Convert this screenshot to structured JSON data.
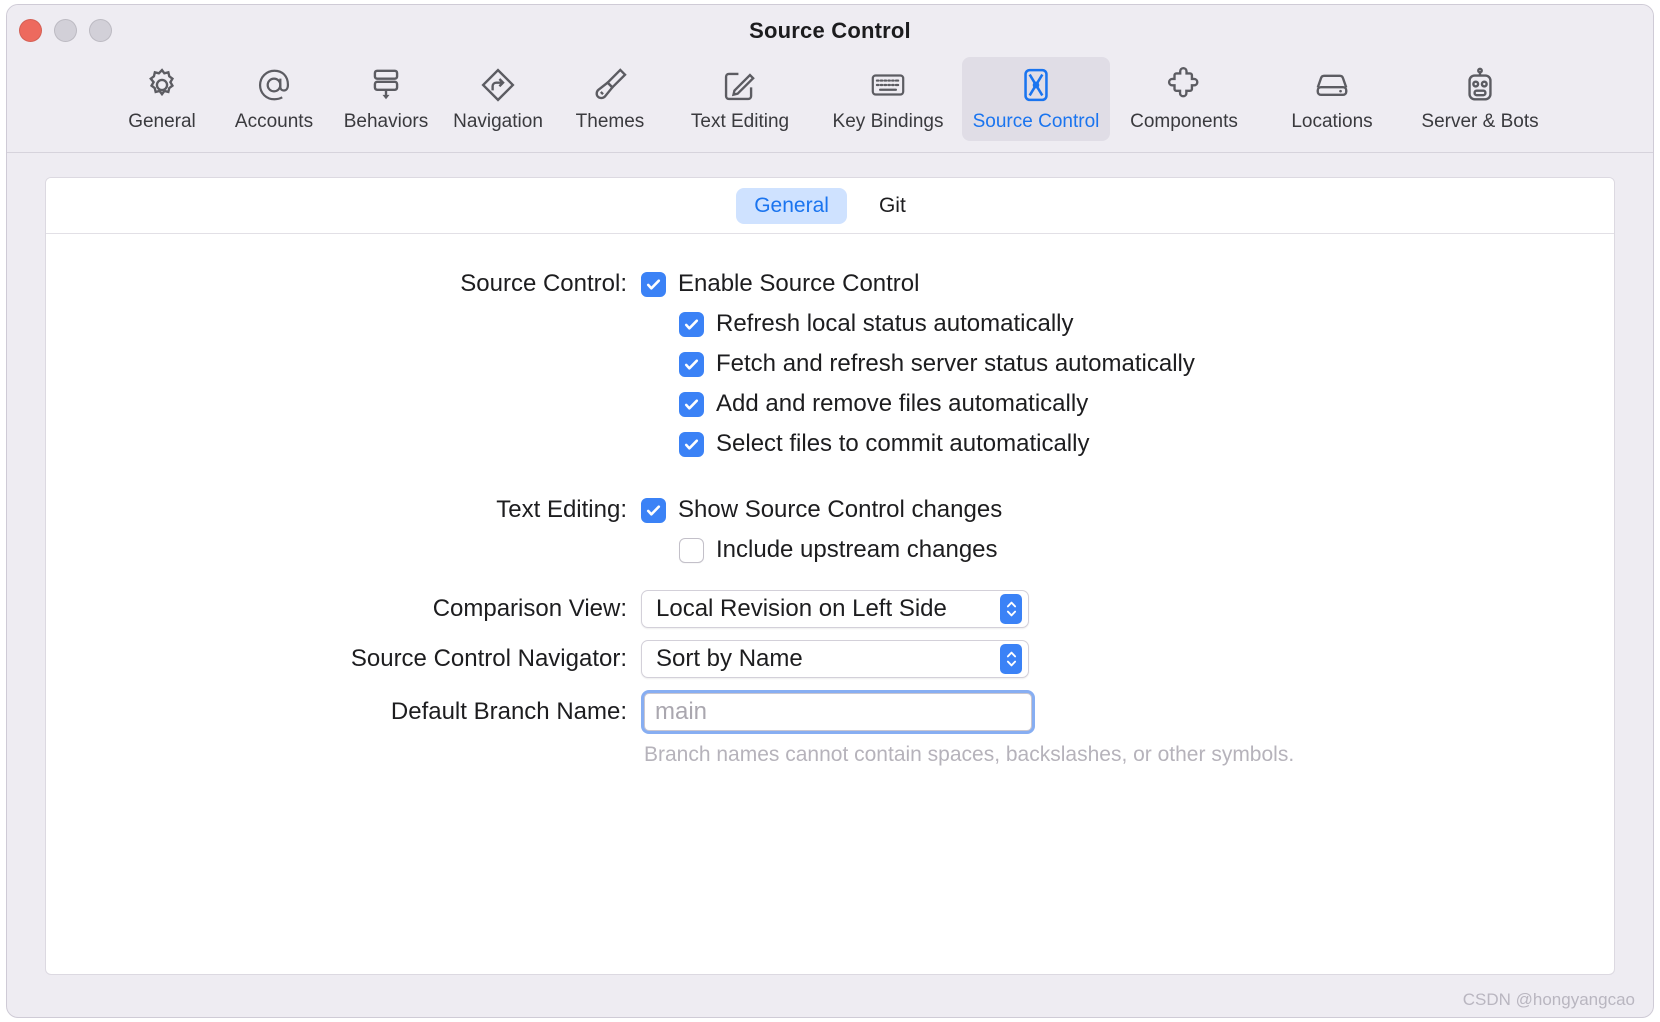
{
  "window": {
    "title": "Source Control",
    "traffic_lights": [
      {
        "name": "close",
        "color": "#ed6a5e"
      },
      {
        "name": "minimize",
        "color": "#d2d0d8"
      },
      {
        "name": "maximize",
        "color": "#d2d0d8"
      }
    ]
  },
  "toolbar": {
    "items": [
      {
        "label": "General",
        "icon": "gear-icon"
      },
      {
        "label": "Accounts",
        "icon": "at-sign-icon"
      },
      {
        "label": "Behaviors",
        "icon": "behaviors-icon"
      },
      {
        "label": "Navigation",
        "icon": "navigation-arrow-icon"
      },
      {
        "label": "Themes",
        "icon": "paintbrush-icon"
      },
      {
        "label": "Text Editing",
        "icon": "pencil-square-icon"
      },
      {
        "label": "Key Bindings",
        "icon": "keyboard-icon"
      },
      {
        "label": "Source Control",
        "icon": "source-control-icon",
        "selected": true
      },
      {
        "label": "Components",
        "icon": "puzzle-piece-icon"
      },
      {
        "label": "Locations",
        "icon": "disk-drive-icon"
      },
      {
        "label": "Server & Bots",
        "icon": "robot-icon"
      }
    ],
    "selected_color": "#1a74ef"
  },
  "tabs": [
    {
      "label": "General",
      "active": true
    },
    {
      "label": "Git",
      "active": false
    }
  ],
  "form": {
    "source_control_label": "Source Control:",
    "text_editing_label": "Text Editing:",
    "comparison_view_label": "Comparison View:",
    "navigator_label": "Source Control Navigator:",
    "branch_label": "Default Branch Name:",
    "checkboxes": [
      {
        "label": "Enable Source Control",
        "checked": true,
        "indent": false
      },
      {
        "label": "Refresh local status automatically",
        "checked": true,
        "indent": true
      },
      {
        "label": "Fetch and refresh server status automatically",
        "checked": true,
        "indent": true
      },
      {
        "label": "Add and remove files automatically",
        "checked": true,
        "indent": true
      },
      {
        "label": "Select files to commit automatically",
        "checked": true,
        "indent": true
      },
      {
        "label": "Show Source Control changes",
        "checked": true,
        "indent": false
      },
      {
        "label": "Include upstream changes",
        "checked": false,
        "indent": true
      }
    ],
    "comparison_view_value": "Local Revision on Left Side",
    "navigator_value": "Sort by Name",
    "branch_value": "",
    "branch_placeholder": "main",
    "branch_helper": "Branch names cannot contain spaces, backslashes, or other symbols.",
    "accent_color": "#3b82f6"
  },
  "watermark": "CSDN @hongyangcao"
}
